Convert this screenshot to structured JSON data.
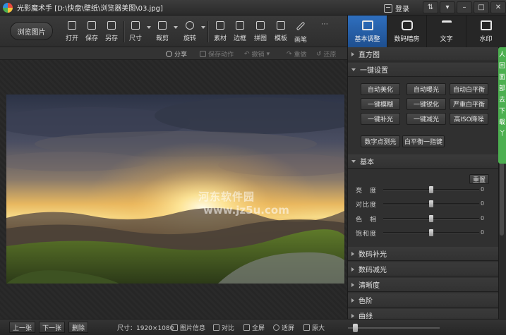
{
  "window": {
    "title": "光影魔术手 [D:\\快盘\\壁纸\\浏览器美图\\03.jpg]",
    "login_label": "登录",
    "controls": [
      "⇅",
      "▾",
      "–",
      "□",
      "✕"
    ]
  },
  "toolbar": {
    "browse_label": "浏览图片",
    "tools": [
      {
        "label": "打开",
        "icon": "open-icon"
      },
      {
        "label": "保存",
        "icon": "save-icon"
      },
      {
        "label": "另存",
        "icon": "save-as-icon"
      },
      {
        "label": "尺寸",
        "icon": "resize-icon"
      },
      {
        "label": "裁剪",
        "icon": "crop-icon"
      },
      {
        "label": "旋转",
        "icon": "rotate-icon"
      },
      {
        "label": "素材",
        "icon": "material-icon"
      },
      {
        "label": "边框",
        "icon": "border-icon"
      },
      {
        "label": "拼图",
        "icon": "collage-icon"
      },
      {
        "label": "模板",
        "icon": "template-icon"
      },
      {
        "label": "画笔",
        "icon": "brush-icon"
      }
    ]
  },
  "mode_tabs": [
    {
      "label": "基本调整",
      "icon": "basic-adjust-icon"
    },
    {
      "label": "数码暗房",
      "icon": "darkroom-icon"
    },
    {
      "label": "文字",
      "icon": "text-icon"
    },
    {
      "label": "水印",
      "icon": "watermark-icon"
    }
  ],
  "action_bar": {
    "share": "分享",
    "save_action": "保存动作",
    "undo": "撤销",
    "redo": "重做",
    "restore": "还原"
  },
  "photo": {
    "watermark_line1": "河东软件园",
    "watermark_line2": "www.jz5u.com"
  },
  "panel": {
    "histogram": "直方图",
    "one_key": "一键设置",
    "one_key_buttons": [
      [
        "自动美化",
        "自动曝光",
        "自动白平衡"
      ],
      [
        "一键模糊",
        "一键锐化",
        "严重白平衡"
      ],
      [
        "一键补光",
        "一键减光",
        "高ISO降噪"
      ]
    ],
    "extra_buttons": [
      "数字点测光",
      "白平衡一指键"
    ],
    "basic": "基本",
    "reset": "重置",
    "sliders": [
      {
        "label": "亮　度",
        "value": "0",
        "level": 0.5
      },
      {
        "label": "对比度",
        "value": "0",
        "level": 0.5
      },
      {
        "label": "色　相",
        "value": "0",
        "level": 0.5
      },
      {
        "label": "饱和度",
        "value": "0",
        "level": 0.5
      }
    ],
    "collapsed_sections": [
      "数码补光",
      "数码减光",
      "清晰度",
      "色阶",
      "曲线"
    ]
  },
  "side_tab": {
    "chars": [
      "人",
      "回",
      "面",
      "部",
      "去",
      "下",
      "载",
      "丫"
    ]
  },
  "status_bar": {
    "prev": "上一张",
    "next": "下一张",
    "delete": "删除",
    "size": "尺寸：1920×1080",
    "info": "图片信息",
    "compare": "对比",
    "fullscreen": "全屏",
    "fit": "适屏",
    "original": "原大",
    "zoom_level": 0.05
  }
}
